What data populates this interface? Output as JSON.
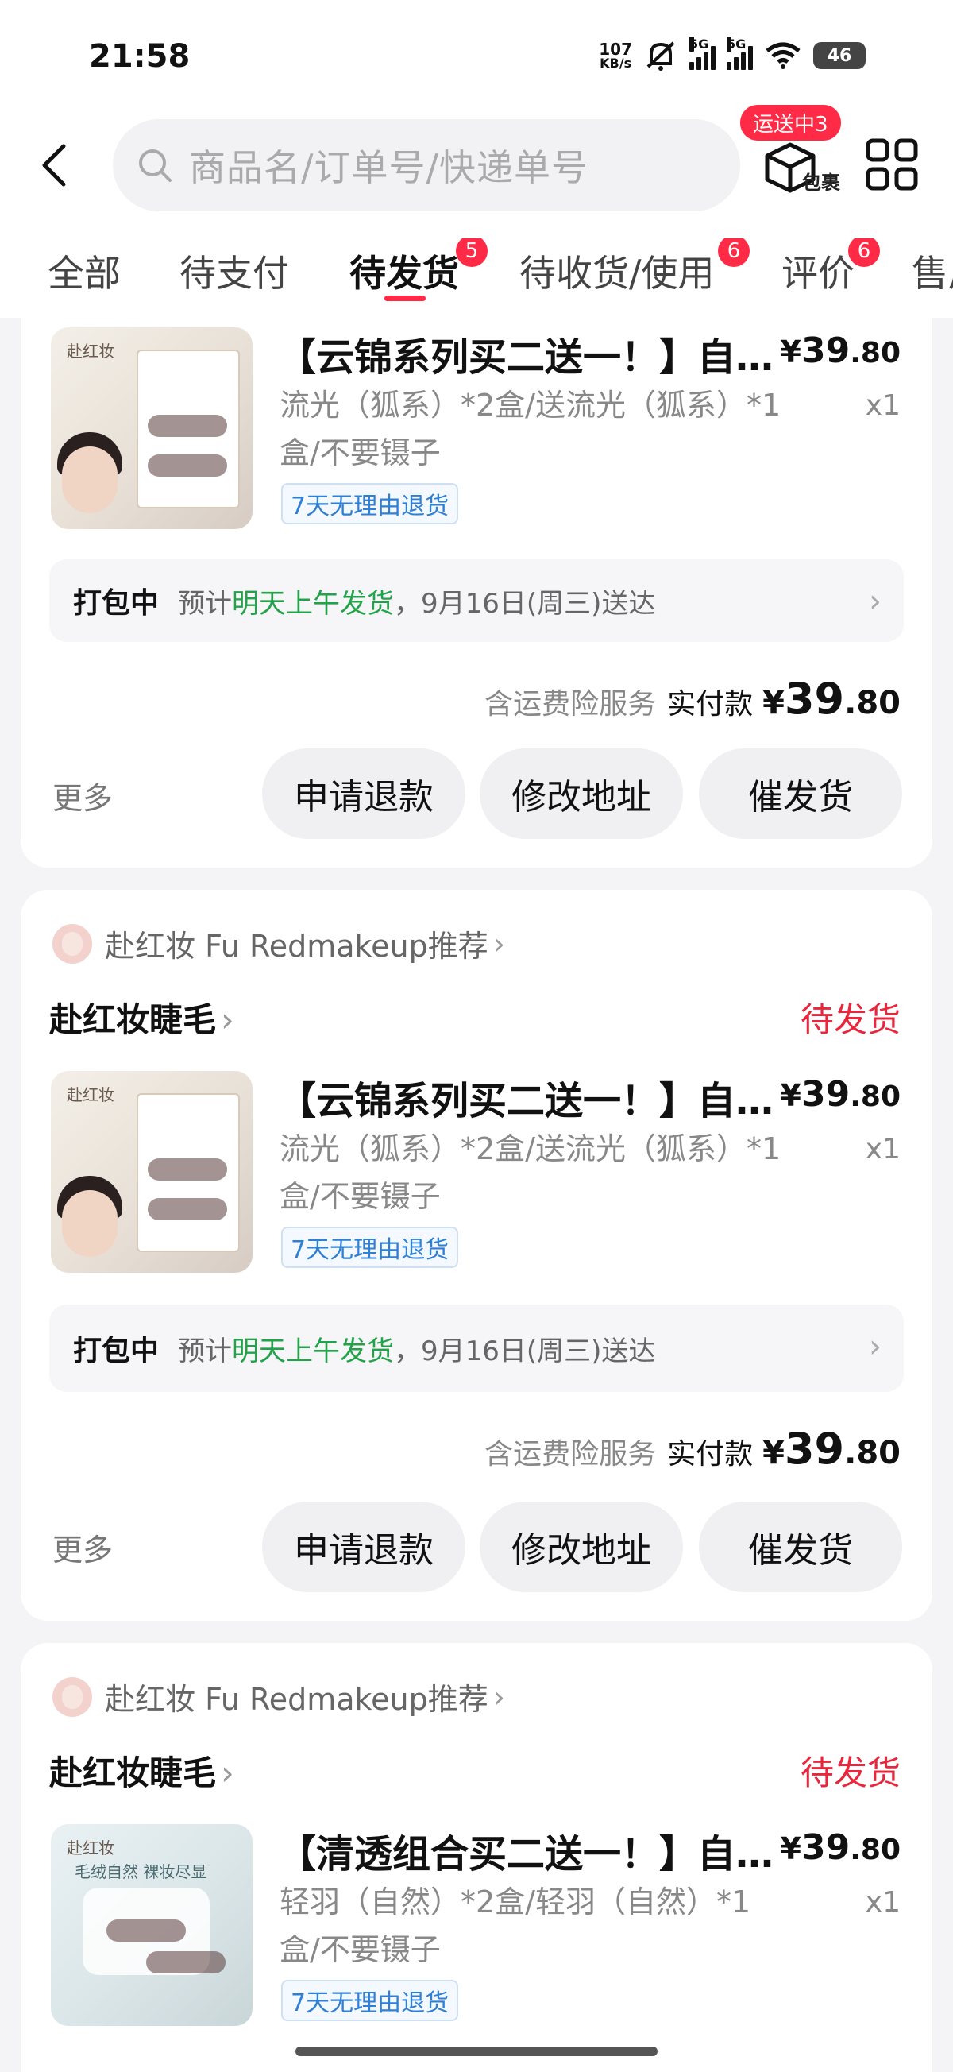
{
  "status": {
    "time": "21:58",
    "net_speed": "107",
    "net_unit": "KB/s",
    "sim1": "5G",
    "sim2": "5G",
    "wifi_num": "6",
    "battery": "46"
  },
  "header": {
    "search_placeholder": "商品名/订单号/快递单号",
    "transit_badge": "运送中3",
    "parcel_label": "包裹"
  },
  "tabs": [
    {
      "label": "全部",
      "badge": ""
    },
    {
      "label": "待支付",
      "badge": ""
    },
    {
      "label": "待发货",
      "badge": "5"
    },
    {
      "label": "待收货/使用",
      "badge": "6"
    },
    {
      "label": "评价",
      "badge": "6"
    },
    {
      "label": "售后",
      "badge": ""
    }
  ],
  "orders": [
    {
      "shop_rec": "",
      "shop_name": "",
      "state": "",
      "title": "【云锦系列买二送一！】自…",
      "price_int": "39",
      "price_cents": ".80",
      "currency": "¥",
      "spec": "流光（狐系）*2盒/送流光（狐系）*1盒/不要镊子",
      "qty": "x1",
      "tag": "7天无理由退货",
      "ship_status": "打包中",
      "ship_pre": "预计",
      "ship_green": "明天上午发货",
      "ship_post": "，9月16日(周三)送达",
      "service": "含运费险服务",
      "paid_label": "实付款",
      "paid_int": "39",
      "paid_cents": ".80",
      "more": "更多",
      "btn1": "申请退款",
      "btn2": "修改地址",
      "btn3": "催发货"
    },
    {
      "shop_rec": "赴红妆 Fu Redmakeup推荐",
      "shop_name": "赴红妆睫毛",
      "state": "待发货",
      "title": "【云锦系列买二送一！】自…",
      "price_int": "39",
      "price_cents": ".80",
      "currency": "¥",
      "spec": "流光（狐系）*2盒/送流光（狐系）*1盒/不要镊子",
      "qty": "x1",
      "tag": "7天无理由退货",
      "ship_status": "打包中",
      "ship_pre": "预计",
      "ship_green": "明天上午发货",
      "ship_post": "，9月16日(周三)送达",
      "service": "含运费险服务",
      "paid_label": "实付款",
      "paid_int": "39",
      "paid_cents": ".80",
      "more": "更多",
      "btn1": "申请退款",
      "btn2": "修改地址",
      "btn3": "催发货"
    },
    {
      "shop_rec": "赴红妆 Fu Redmakeup推荐",
      "shop_name": "赴红妆睫毛",
      "state": "待发货",
      "title": "【清透组合买二送一！】自…",
      "price_int": "39",
      "price_cents": ".80",
      "currency": "¥",
      "spec": "轻羽（自然）*2盒/轻羽（自然）*1盒/不要镊子",
      "qty": "x1",
      "tag": "7天无理由退货"
    }
  ],
  "thumb_text": {
    "brand": "赴红妆",
    "series": "云锦系列",
    "banner2": "毛绒自然 裸妆尽显"
  },
  "colors": {
    "accent": "#ff2a45",
    "state_red": "#e8263c",
    "ship_green": "#22a34a",
    "tag_blue": "#2e7fd6"
  }
}
